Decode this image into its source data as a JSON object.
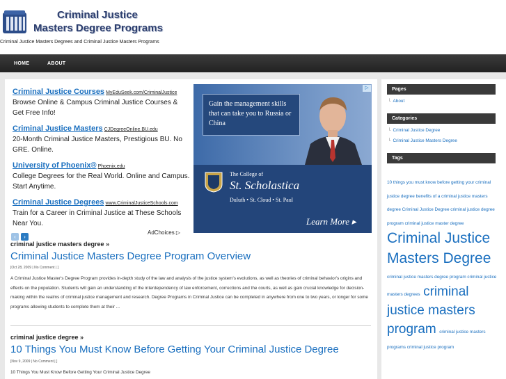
{
  "header": {
    "title_line1": "Criminal Justice",
    "title_line2": "Masters Degree Programs",
    "tagline": "Criminal Justice Masters Degrees and Criminal Justice Masters Programs"
  },
  "nav": {
    "items": [
      "HOME",
      "ABOUT"
    ]
  },
  "ads": [
    {
      "title": "Criminal Justice Courses",
      "url": "MyEduSeek.com/CriminalJustice",
      "desc": "Browse Online & Campus Criminal Justice Courses & Get Free Info!"
    },
    {
      "title": "Criminal Justice Masters",
      "url": "CJDegreeOnline.BU.edu",
      "desc": "20-Month Criminal Justice Masters, Prestigious BU. No GRE. Online."
    },
    {
      "title": "University of Phoenix®",
      "url": "Phoenix.edu",
      "desc": "College Degrees for the Real World. Online and Campus. Start Anytime."
    },
    {
      "title": "Criminal Justice Degrees",
      "url": "www.CriminalJusticeSchools.com",
      "desc": "Train for a Career in Criminal Justice at These Schools Near You."
    }
  ],
  "ad_nav": {
    "prev": "‹",
    "next": "›",
    "adchoices": "AdChoices"
  },
  "banner": {
    "pitch": "Gain the management skills that can take you to Russia or China",
    "college_small": "The College of",
    "college_name": "St. Scholastica",
    "campuses": "Duluth  •  St. Cloud  •  St. Paul",
    "cta": "Learn More ▸",
    "info_icon": "▷"
  },
  "posts": [
    {
      "category": "criminal justice masters degree »",
      "title": "Criminal Justice Masters Degree Program Overview",
      "meta": "[Oct 28, 2009 | No Comment | ]",
      "excerpt": "A Criminal Justice Master's Degree Program provides in-depth study of the law and analysis of the justice system's evolutions, as well as theories of criminal behavior's origins and effects on the population. Students will gain an understanding of the interdependency of law enforcement, corrections and the courts, as well as gain crucial knowledge for decision-making within the realms of criminal justice management and research. Degree Programs in Criminal Justice can be completed in anywhere from one to two years, or longer for some programs allowing students to complete them at their ..."
    },
    {
      "category": "criminal justice degree »",
      "title": "10 Things You Must Know Before Getting Your Criminal Justice Degree",
      "meta": "[Nov 9, 2009 | No Comment | ]",
      "excerpt": "10 Things You Must Know Before Getting Your Criminal Justice Degree"
    }
  ],
  "sidebar": {
    "pages": {
      "heading": "Pages",
      "items": [
        "About"
      ]
    },
    "categories": {
      "heading": "Categories",
      "items": [
        "Criminal Justice Degree",
        "Criminal Justice Masters Degree"
      ]
    },
    "tags": {
      "heading": "Tags",
      "small_1": "10 things you must know before getting your criminal justice degree benefits of a criminal justice masters degree Criminal Justice Degree criminal justice degree program criminal justice master degree",
      "large_1": "Criminal Justice Masters Degree",
      "small_2": "criminal justice masters degree program criminal justice masters degrees",
      "large_2": "criminal justice masters program",
      "small_3": "criminal justice masters programs criminal justice program"
    }
  },
  "colors": {
    "accent": "#1a6fbf",
    "nav_bg": "#2b2b2b",
    "title": "#2c3e6e"
  }
}
